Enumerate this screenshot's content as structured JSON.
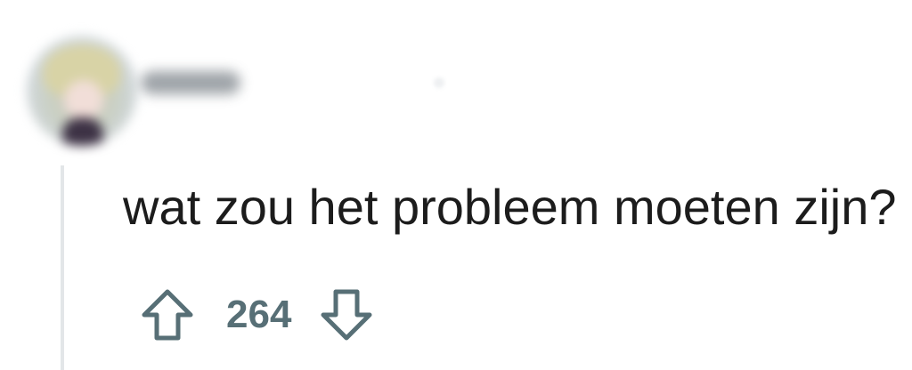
{
  "comment": {
    "body": "wat zou het probleem moeten zijn?",
    "score": "264"
  },
  "icons": {
    "upvote": "arrow-up-outline-icon",
    "downvote": "arrow-down-outline-icon"
  },
  "colors": {
    "text": "#1c1c1c",
    "vote_icon": "#576f76",
    "thread_line": "#e3e6e8",
    "background": "#ffffff"
  }
}
